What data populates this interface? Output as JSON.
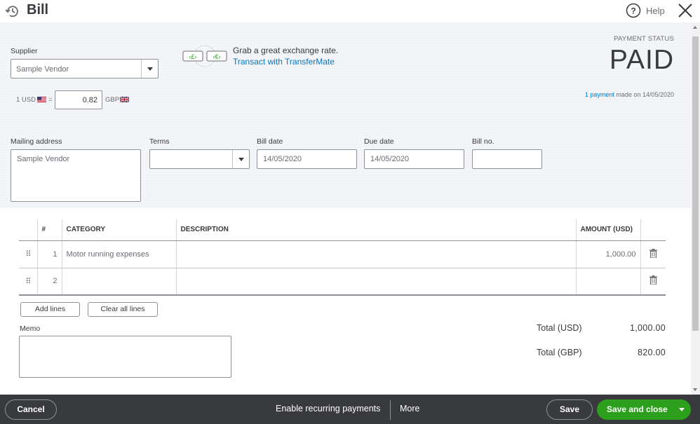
{
  "header": {
    "title": "Bill",
    "help_label": "Help",
    "icons": [
      "history-icon",
      "help-icon",
      "close-icon"
    ]
  },
  "supplier": {
    "label": "Supplier",
    "value": "Sample Vendor"
  },
  "exchange": {
    "base": "1 USD",
    "equals": "=",
    "rate": "0.82",
    "target": "GBP"
  },
  "transfermate": {
    "text": "Grab a great exchange rate.",
    "link": "Transact with TransferMate"
  },
  "payment_status": {
    "label": "PAYMENT STATUS",
    "value": "PAID",
    "payment_link": "1 payment",
    "payment_info": "made on 14/05/2020"
  },
  "fields": {
    "mailing_address_label": "Mailing address",
    "mailing_address_value": "Sample Vendor",
    "terms_label": "Terms",
    "terms_value": "",
    "bill_date_label": "Bill date",
    "bill_date_value": "14/05/2020",
    "due_date_label": "Due date",
    "due_date_value": "14/05/2020",
    "bill_no_label": "Bill no.",
    "bill_no_value": ""
  },
  "table": {
    "headers": [
      "#",
      "CATEGORY",
      "DESCRIPTION",
      "AMOUNT (USD)"
    ],
    "rows": [
      {
        "num": "1",
        "category": "Motor running expenses",
        "description": "",
        "amount": "1,000.00"
      },
      {
        "num": "2",
        "category": "",
        "description": "",
        "amount": ""
      }
    ]
  },
  "buttons": {
    "add_lines": "Add lines",
    "clear_lines": "Clear all lines"
  },
  "memo": {
    "label": "Memo",
    "value": ""
  },
  "totals": {
    "usd_label": "Total (USD)",
    "usd_value": "1,000.00",
    "gbp_label": "Total (GBP)",
    "gbp_value": "820.00"
  },
  "footer": {
    "cancel": "Cancel",
    "recurring": "Enable recurring payments",
    "more": "More",
    "save": "Save",
    "save_close": "Save and close"
  },
  "colors": {
    "link": "#0077c5",
    "primary_button": "#2ca01c",
    "footer_bg": "#393a3d"
  }
}
